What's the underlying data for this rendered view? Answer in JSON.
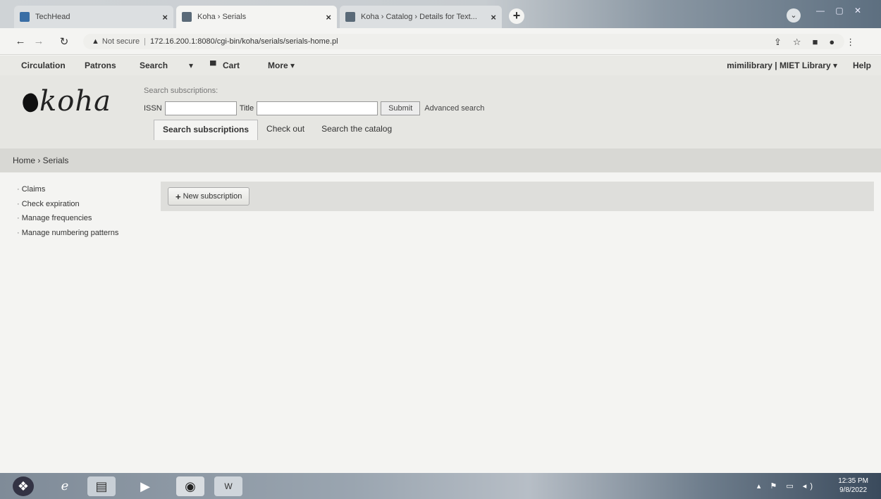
{
  "browser": {
    "tabs": [
      {
        "label": "TechHead"
      },
      {
        "label": "Koha › Serials"
      },
      {
        "label": "Koha › Catalog › Details for Text..."
      }
    ],
    "address": {
      "security": "Not secure",
      "url": "172.16.200.1:8080/cgi-bin/koha/serials/serials-home.pl"
    }
  },
  "kohanav": {
    "circulation": "Circulation",
    "patrons": "Patrons",
    "search": "Search",
    "cart": "Cart",
    "more": "More ▾",
    "user": "mimilibrary | MIET Library ▾",
    "help": "Help"
  },
  "header": {
    "logo": "koha",
    "search_caption": "Search subscriptions:",
    "issn_label": "ISSN",
    "title_label": "Title",
    "submit_label": "Submit",
    "advanced_search": "Advanced search",
    "subtabs": [
      "Search subscriptions",
      "Check out",
      "Search the catalog"
    ]
  },
  "breadcrumb": "Home › Serials",
  "sidebar": {
    "items": [
      "Claims",
      "Check expiration",
      "Manage frequencies",
      "Manage numbering patterns"
    ]
  },
  "toolbar": {
    "new_subscription": "New subscription"
  },
  "taskbar": {
    "time": "12:35 PM",
    "date": "9/8/2022"
  }
}
